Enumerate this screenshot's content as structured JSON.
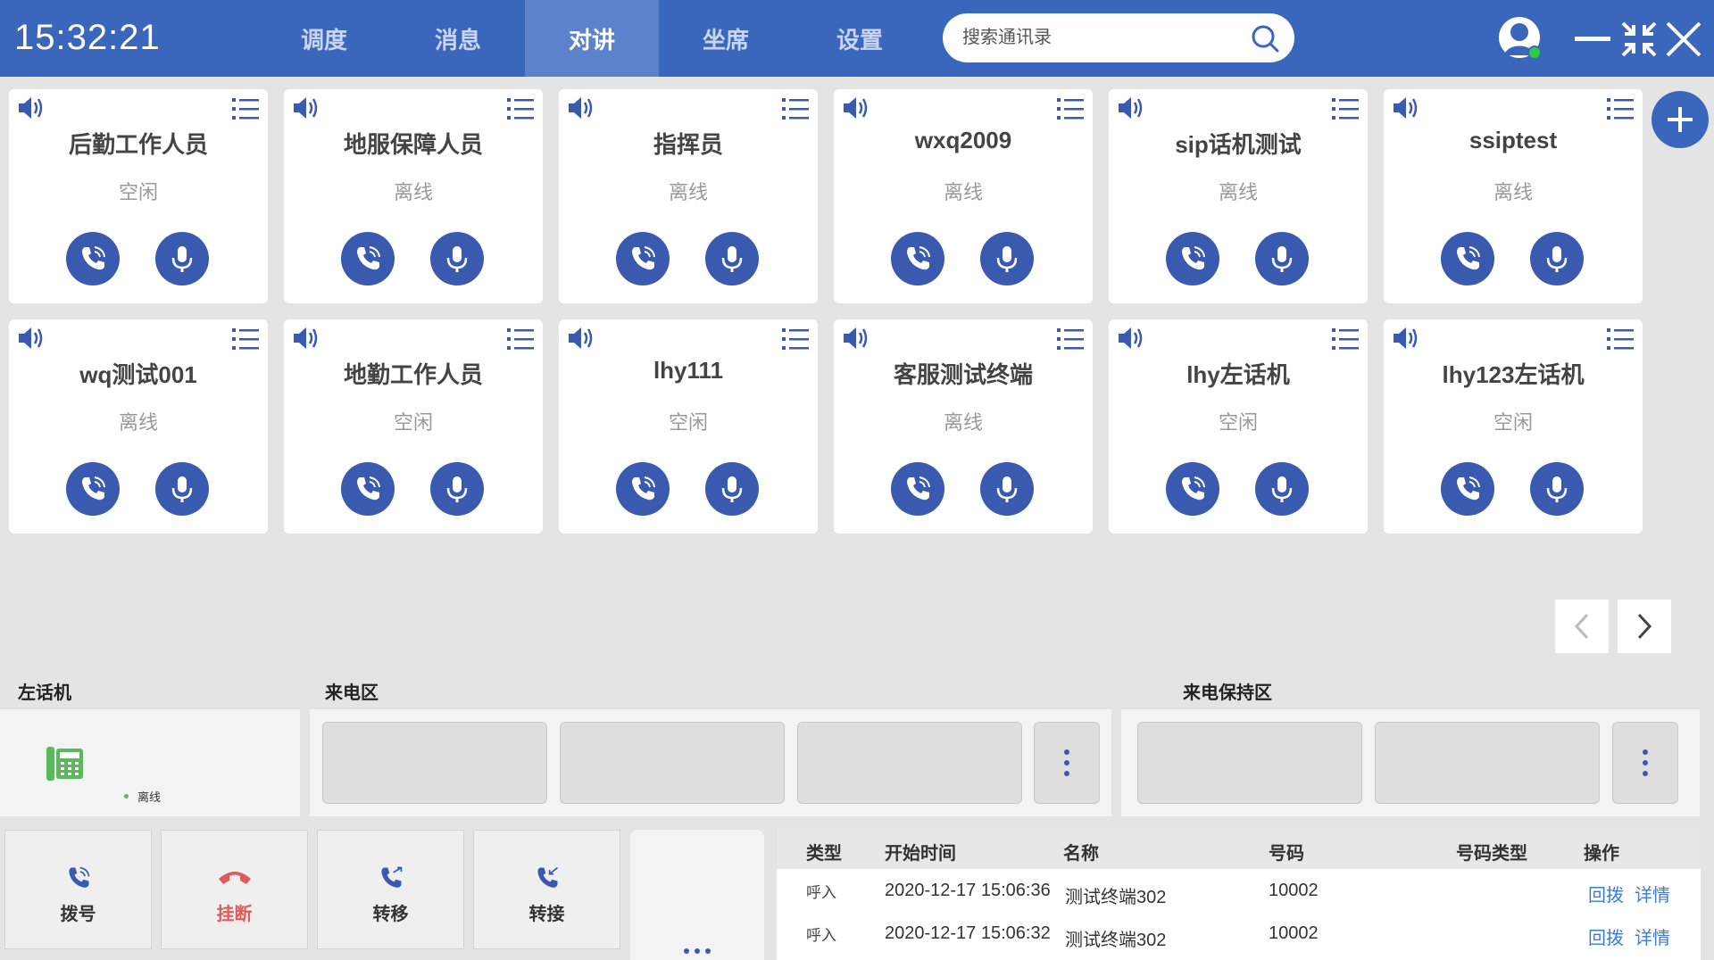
{
  "header": {
    "time": "15:32:21",
    "nav": [
      "调度",
      "消息",
      "对讲",
      "坐席",
      "设置"
    ],
    "active_nav": "对讲",
    "search_placeholder": "搜索通讯录"
  },
  "colors": {
    "header_bg": "#3a66bb",
    "active_tab": "#5b82cb",
    "button_blue": "#3a5ab0",
    "hangup_red": "#e05a5a",
    "link_blue": "#3a7cd8"
  },
  "cards": [
    {
      "name": "后勤工作人员",
      "status": "空闲"
    },
    {
      "name": "地服保障人员",
      "status": "离线"
    },
    {
      "name": "指挥员",
      "status": "离线"
    },
    {
      "name": "wxq2009",
      "status": "离线"
    },
    {
      "name": "sip话机测试",
      "status": "离线"
    },
    {
      "name": "ssiptest",
      "status": "离线"
    },
    {
      "name": "wq测试001",
      "status": "离线"
    },
    {
      "name": "地勤工作人员",
      "status": "空闲"
    },
    {
      "name": "lhy111",
      "status": "空闲"
    },
    {
      "name": "客服测试终端",
      "status": "离线"
    },
    {
      "name": "lhy左话机",
      "status": "空闲"
    },
    {
      "name": "lhy123左话机",
      "status": "空闲"
    }
  ],
  "sections": {
    "left_phone": "左话机",
    "incoming": "来电区",
    "hold": "来电保持区",
    "phone_status": "离线"
  },
  "actions": [
    {
      "label": "拨号",
      "icon": "dial-icon"
    },
    {
      "label": "挂断",
      "icon": "hangup-icon"
    },
    {
      "label": "转移",
      "icon": "transfer-icon"
    },
    {
      "label": "转接",
      "icon": "forward-icon"
    }
  ],
  "table": {
    "headers": [
      "类型",
      "开始时间",
      "名称",
      "号码",
      "号码类型",
      "操作"
    ],
    "rows": [
      {
        "type": "呼入",
        "time": "2020-12-17 15:06:36",
        "name": "测试终端302",
        "number": "10002",
        "num_type": "",
        "ops": [
          "回拨",
          "详情"
        ]
      },
      {
        "type": "呼入",
        "time": "2020-12-17 15:06:32",
        "name": "测试终端302",
        "number": "10002",
        "num_type": "",
        "ops": [
          "回拨",
          "详情"
        ]
      }
    ]
  }
}
